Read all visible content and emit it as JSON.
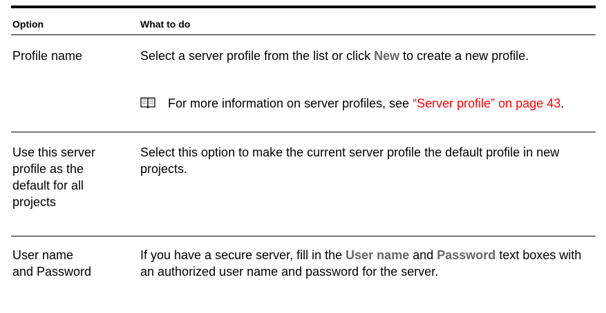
{
  "header": {
    "option": "Option",
    "what_to_do": "What to do"
  },
  "rows": [
    {
      "option": "Profile name",
      "desc_before": "Select a server profile from the list or click ",
      "desc_kw": "New",
      "desc_after": " to create a new profile.",
      "note_text": "For more information on server profiles, see ",
      "note_link": "“Server profile” on page 43",
      "note_end": "."
    },
    {
      "option": "Use this server profile as the default for all projects",
      "desc": "Select this option to make the current server profile the default profile in new projects."
    },
    {
      "option": "User name and Password",
      "desc_1": "If you have a secure server, fill in the ",
      "kw_1": "User name",
      "desc_2": " and ",
      "kw_2": "Password",
      "desc_3": " text boxes with an authorized user name and password for the server."
    }
  ],
  "icons": {
    "note": "book-icon"
  }
}
